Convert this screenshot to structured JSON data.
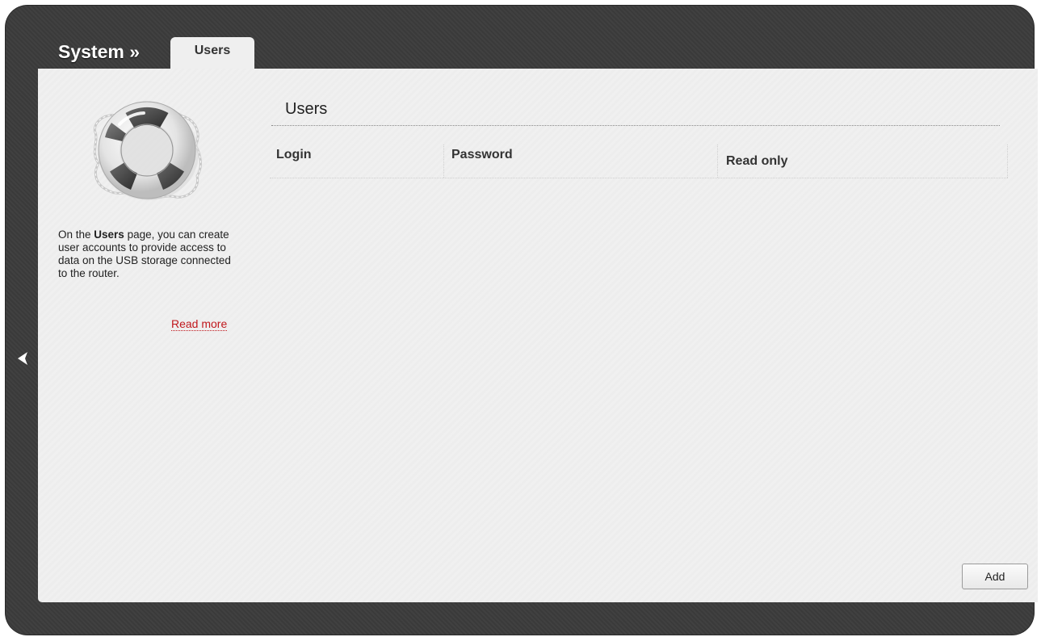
{
  "header": {
    "section_title": "System »",
    "active_tab": "Users"
  },
  "sidebar": {
    "icon": "lifebuoy-icon",
    "help_prefix": "On the ",
    "help_bold": "Users",
    "help_suffix": " page, you can create user accounts to provide access to data on the USB storage connected to the router.",
    "read_more": "Read more"
  },
  "nav": {
    "back_icon": "chevron-left-icon"
  },
  "main": {
    "title": "Users",
    "columns": [
      "Login",
      "Password",
      "Read only"
    ],
    "rows": [],
    "add_label": "Add"
  },
  "colors": {
    "frame": "#3c3c3c",
    "panel": "#f0f0f0",
    "link": "#c0181d"
  }
}
